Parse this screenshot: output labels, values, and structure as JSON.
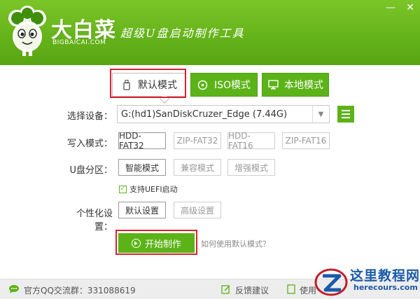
{
  "header": {
    "brand_cn": "大白菜",
    "brand_en": "BIGBAICAI.COM",
    "slogan": "超级U盘启动制作工具",
    "minimize_icon": "minimize-icon",
    "close_icon": "close-icon",
    "header_color": "#64b21a"
  },
  "tabs": [
    {
      "label": "默认模式",
      "icon": "usb-icon",
      "active": true
    },
    {
      "label": "ISO模式",
      "icon": "disc-icon",
      "active": false
    },
    {
      "label": "本地模式",
      "icon": "monitor-icon",
      "active": false
    }
  ],
  "form": {
    "device_label": "选择设备：",
    "device_value": "G:(hd1)SanDiskCruzer_Edge (7.44G)",
    "write_mode_label": "写入模式：",
    "write_modes": [
      "HDD-FAT32",
      "ZIP-FAT32",
      "HDD-FAT16",
      "ZIP-FAT16"
    ],
    "write_mode_selected": "HDD-FAT32",
    "partition_label": "U盘分区：",
    "partition_modes": [
      "智能模式",
      "兼容模式",
      "增强模式"
    ],
    "partition_selected": "智能模式",
    "uefi_label": "支持UEFI启动",
    "uefi_checked": true,
    "personalize_label": "个性化设置：",
    "personalize_options": [
      "默认设置",
      "高级设置"
    ],
    "personalize_selected": "默认设置"
  },
  "actions": {
    "start_label": "开始制作",
    "help_link": "如何使用默认模式？"
  },
  "footer": {
    "qq_group": "官方QQ交流群：331088619",
    "feedback": "反馈建议",
    "usage": "使用"
  },
  "watermark": {
    "title": "这里教程网",
    "sub": "herecours.com"
  },
  "accent_color": "#5cb318",
  "highlight_color": "#d9232d"
}
